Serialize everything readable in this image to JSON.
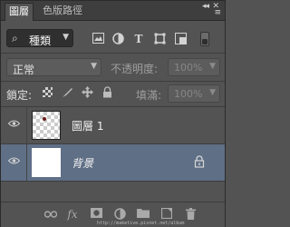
{
  "tabs": [
    {
      "label": "圖層",
      "active": true
    },
    {
      "label": "色版路徑"
    }
  ],
  "tab_controls": {
    "collapse": "◂◂",
    "close": "✕",
    "menu": "≡"
  },
  "filter": {
    "kind_label": "種類",
    "icons": [
      "image-filter-icon",
      "adjustment-filter-icon",
      "type-filter-icon",
      "shape-filter-icon",
      "smart-object-filter-icon"
    ]
  },
  "blend": {
    "mode": "正常",
    "opacity_label": "不透明度:",
    "opacity_value": "100%"
  },
  "lock": {
    "label": "鎖定:",
    "fill_label": "填滿:",
    "fill_value": "100%"
  },
  "layers": [
    {
      "name": "圖層 1",
      "visible": true,
      "thumb": "transparent"
    },
    {
      "name": "背景",
      "visible": true,
      "thumb": "white",
      "locked": true,
      "italic": true
    }
  ],
  "bottom_icons": [
    "link-icon",
    "fx-icon",
    "mask-icon",
    "adjustment-icon",
    "group-folder-icon",
    "new-layer-icon",
    "trash-icon"
  ],
  "watermark": "http://maketive.pixnet.net/album",
  "colors": {
    "panel_bg": "#535353",
    "selected_row": "#5f6f86",
    "tabbar_bg": "#3e3e3e"
  }
}
